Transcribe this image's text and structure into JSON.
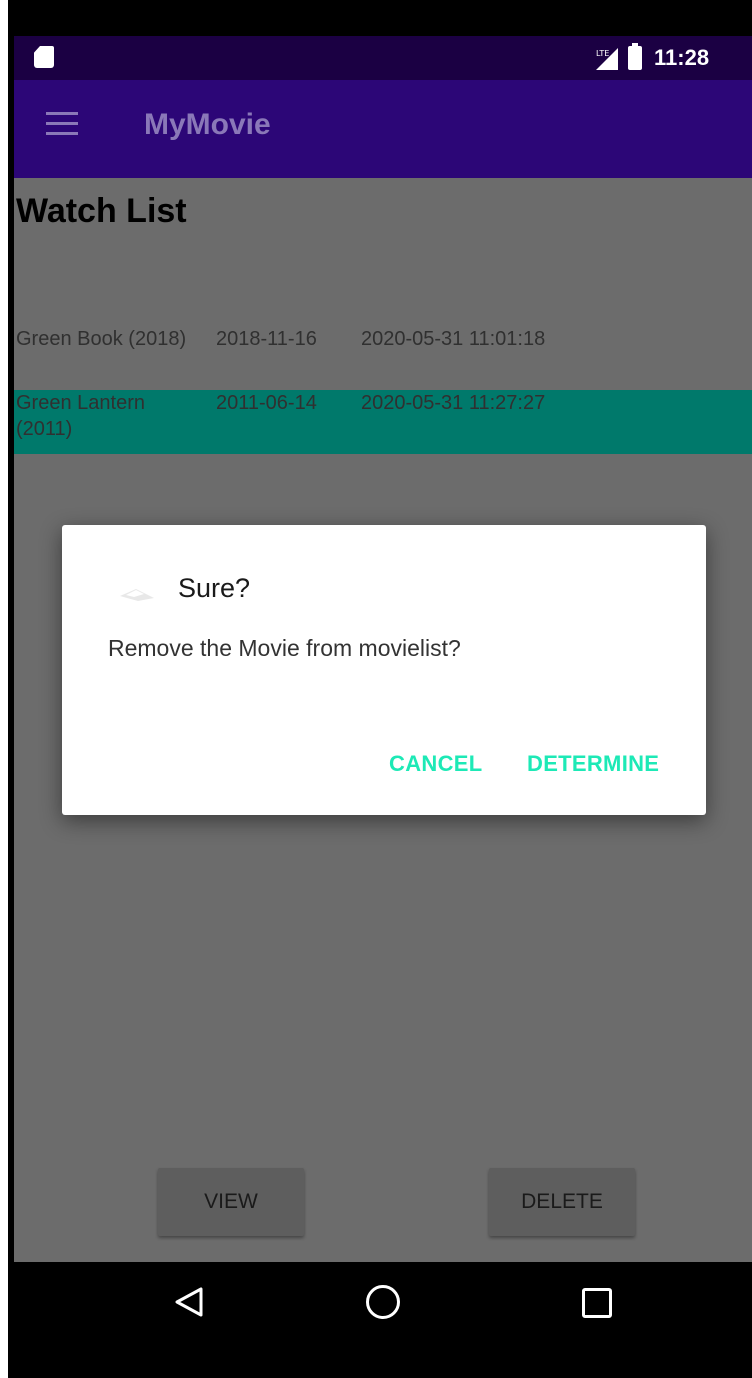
{
  "status_bar": {
    "time": "11:28",
    "network_label": "LTE",
    "icons": [
      "sd-card-icon",
      "signal-icon",
      "battery-icon"
    ]
  },
  "app_bar": {
    "title": "MyMovie",
    "menu_icon": "menu-icon"
  },
  "page": {
    "heading": "Watch List",
    "movies": [
      {
        "title": "Green Book (2018)",
        "release_date": "2018-11-16",
        "added": "2020-05-31 11:01:18",
        "selected": false
      },
      {
        "title": "Green Lantern (2011)",
        "release_date": "2011-06-14",
        "added": "2020-05-31 11:27:27",
        "selected": true
      }
    ],
    "buttons": {
      "view": "VIEW",
      "delete": "DELETE"
    }
  },
  "dialog": {
    "icon": "alert-icon",
    "title": "Sure?",
    "message": "Remove the Movie from movielist?",
    "cancel": "CANCEL",
    "confirm": "DETERMINE"
  },
  "nav_bar": {
    "icons": [
      "back-icon",
      "home-icon",
      "recents-icon"
    ]
  },
  "colors": {
    "status_bar": "#1b0043",
    "app_bar": "#2c0677",
    "selected_row": "#00796b",
    "dialog_button": "#1de9b6",
    "content_overlay": "#6c6c6c"
  }
}
